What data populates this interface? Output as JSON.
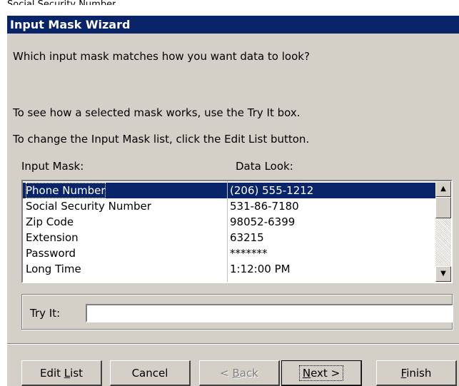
{
  "top_cut_text": "Social Security Number",
  "window": {
    "title": "Input Mask Wizard"
  },
  "instructions": {
    "question": "Which input mask matches how you want data to look?",
    "try_hint": "To see how a selected mask works, use the Try It box.",
    "edit_hint": "To change the Input Mask list, click the Edit List button."
  },
  "list": {
    "headers": {
      "mask": "Input Mask:",
      "look": "Data Look:"
    },
    "rows": [
      {
        "mask": "Phone Number",
        "look": "(206) 555-1212",
        "selected": true
      },
      {
        "mask": "Social Security Number",
        "look": "531-86-7180"
      },
      {
        "mask": "Zip Code",
        "look": "98052-6399"
      },
      {
        "mask": "Extension",
        "look": "63215"
      },
      {
        "mask": "Password",
        "look": "*******"
      },
      {
        "mask": "Long Time",
        "look": "1:12:00 PM"
      }
    ],
    "scroll_up_glyph": "▲",
    "scroll_down_glyph": "▼"
  },
  "try_it": {
    "label": "Try It:",
    "value": ""
  },
  "buttons": {
    "edit_list": {
      "pre": "Edit ",
      "accel": "L",
      "post": "ist"
    },
    "cancel": "Cancel",
    "back": {
      "pre": "< ",
      "accel": "B",
      "post": "ack"
    },
    "next": {
      "pre": "",
      "accel": "N",
      "post": "ext >"
    },
    "finish": {
      "pre": "",
      "accel": "F",
      "post": "inish"
    }
  },
  "colors": {
    "titlebar": "#0a246a",
    "dialog": "#d4d0c8",
    "selection": "#0a246a"
  }
}
